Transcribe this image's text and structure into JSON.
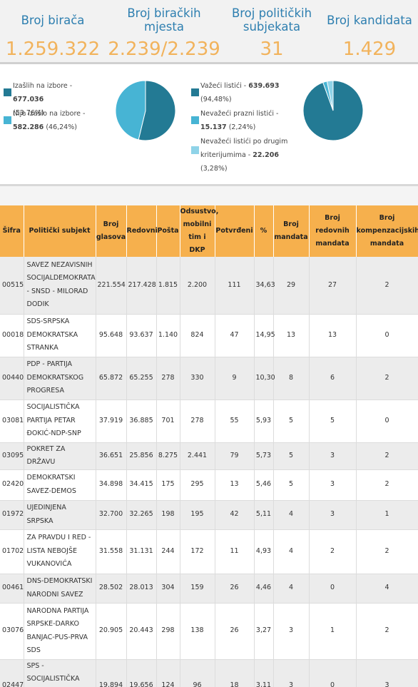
{
  "stats": [
    {
      "label": "Broj birača",
      "value": "1.259.322"
    },
    {
      "label": "Broj biračkih mjesta",
      "value": "2.239/2.239"
    },
    {
      "label": "Broj političkih subjekata",
      "value": "31"
    },
    {
      "label": "Broj kandidata",
      "value": "1.429"
    }
  ],
  "turnout": {
    "items": [
      {
        "label": "Izašlih na izbore - ",
        "value": "677.036",
        "pct": "(53,76%)",
        "share": 0.5376,
        "color": "#237a94"
      },
      {
        "label": "Nije izašlo na izbore - ",
        "value": "582.286",
        "pct": "(46,24%)",
        "share": 0.4624,
        "color": "#47b4d4"
      }
    ]
  },
  "ballots": {
    "items": [
      {
        "label": "Važeći listići - ",
        "value": "639.693",
        "pct": "(94,48%)",
        "share": 0.9448,
        "color": "#237a94"
      },
      {
        "label": "Nevažeći prazni listići - ",
        "value": "15.137",
        "pct": "(2,24%)",
        "share": 0.0224,
        "color": "#47b4d4"
      },
      {
        "label": "Nevažeći listići po drugim kriterijumima - ",
        "value": "22.206",
        "pct": "(3,28%)",
        "share": 0.0328,
        "color": "#8fd3e8"
      }
    ]
  },
  "table": {
    "headers": [
      "Šifra",
      "Politički subjekt",
      "Broj glasova",
      "Redovni",
      "Pošta",
      "Odsustvo, mobilni tim i DKP",
      "Potvrđeni",
      "%",
      "Broj mandata",
      "Broj redovnih mandata",
      "Broj kompenzacijskih mandata"
    ],
    "rows": [
      {
        "code": "00515",
        "name": "SAVEZ NEZAVISNIH SOCIJALDEMOKRATA - SNSD - MILORAD DODIK",
        "votes": "221.554",
        "regular": "217.428",
        "mail": "1.815",
        "absent": "2.200",
        "confirmed": "111",
        "pct": "34,63",
        "seats": "29",
        "reg_seats": "27",
        "comp_seats": "2"
      },
      {
        "code": "00018",
        "name": "SDS-SRPSKA DEMOKRATSKA STRANKA",
        "votes": "95.648",
        "regular": "93.637",
        "mail": "1.140",
        "absent": "824",
        "confirmed": "47",
        "pct": "14,95",
        "seats": "13",
        "reg_seats": "13",
        "comp_seats": "0"
      },
      {
        "code": "00440",
        "name": "PDP - PARTIJA DEMOKRATSKOG PROGRESA",
        "votes": "65.872",
        "regular": "65.255",
        "mail": "278",
        "absent": "330",
        "confirmed": "9",
        "pct": "10,30",
        "seats": "8",
        "reg_seats": "6",
        "comp_seats": "2"
      },
      {
        "code": "03081",
        "name": "SOCIJALISTIČKA PARTIJA PETAR ĐOKIĆ-NDP-SNP",
        "votes": "37.919",
        "regular": "36.885",
        "mail": "701",
        "absent": "278",
        "confirmed": "55",
        "pct": "5,93",
        "seats": "5",
        "reg_seats": "5",
        "comp_seats": "0"
      },
      {
        "code": "03095",
        "name": "POKRET ZA DRŽAVU",
        "votes": "36.651",
        "regular": "25.856",
        "mail": "8.275",
        "absent": "2.441",
        "confirmed": "79",
        "pct": "5,73",
        "seats": "5",
        "reg_seats": "3",
        "comp_seats": "2"
      },
      {
        "code": "02420",
        "name": "DEMOKRATSKI SAVEZ-DEMOS",
        "votes": "34.898",
        "regular": "34.415",
        "mail": "175",
        "absent": "295",
        "confirmed": "13",
        "pct": "5,46",
        "seats": "5",
        "reg_seats": "3",
        "comp_seats": "2"
      },
      {
        "code": "01972",
        "name": "UJEDINJENA SRPSKA",
        "votes": "32.700",
        "regular": "32.265",
        "mail": "198",
        "absent": "195",
        "confirmed": "42",
        "pct": "5,11",
        "seats": "4",
        "reg_seats": "3",
        "comp_seats": "1"
      },
      {
        "code": "01702",
        "name": "ZA PRAVDU I RED - LISTA NEBOJŠE VUKANOVIĆA",
        "votes": "31.558",
        "regular": "31.131",
        "mail": "244",
        "absent": "172",
        "confirmed": "11",
        "pct": "4,93",
        "seats": "4",
        "reg_seats": "2",
        "comp_seats": "2"
      },
      {
        "code": "00461",
        "name": "DNS-DEMOKRATSKI NARODNI SAVEZ",
        "votes": "28.502",
        "regular": "28.013",
        "mail": "304",
        "absent": "159",
        "confirmed": "26",
        "pct": "4,46",
        "seats": "4",
        "reg_seats": "0",
        "comp_seats": "4"
      },
      {
        "code": "03076",
        "name": "NARODNA PARTIJA SRPSKE-DARKO BANJAC-PUS-PRVA SDS",
        "votes": "20.905",
        "regular": "20.443",
        "mail": "298",
        "absent": "138",
        "confirmed": "26",
        "pct": "3,27",
        "seats": "3",
        "reg_seats": "1",
        "comp_seats": "2"
      },
      {
        "code": "02447",
        "name": "SPS - SOCIJALISTIČKA PARTIJA SRPSKE - GORAN SELAK",
        "votes": "19.894",
        "regular": "19.656",
        "mail": "124",
        "absent": "96",
        "confirmed": "18",
        "pct": "3,11",
        "seats": "3",
        "reg_seats": "0",
        "comp_seats": "3"
      }
    ]
  }
}
